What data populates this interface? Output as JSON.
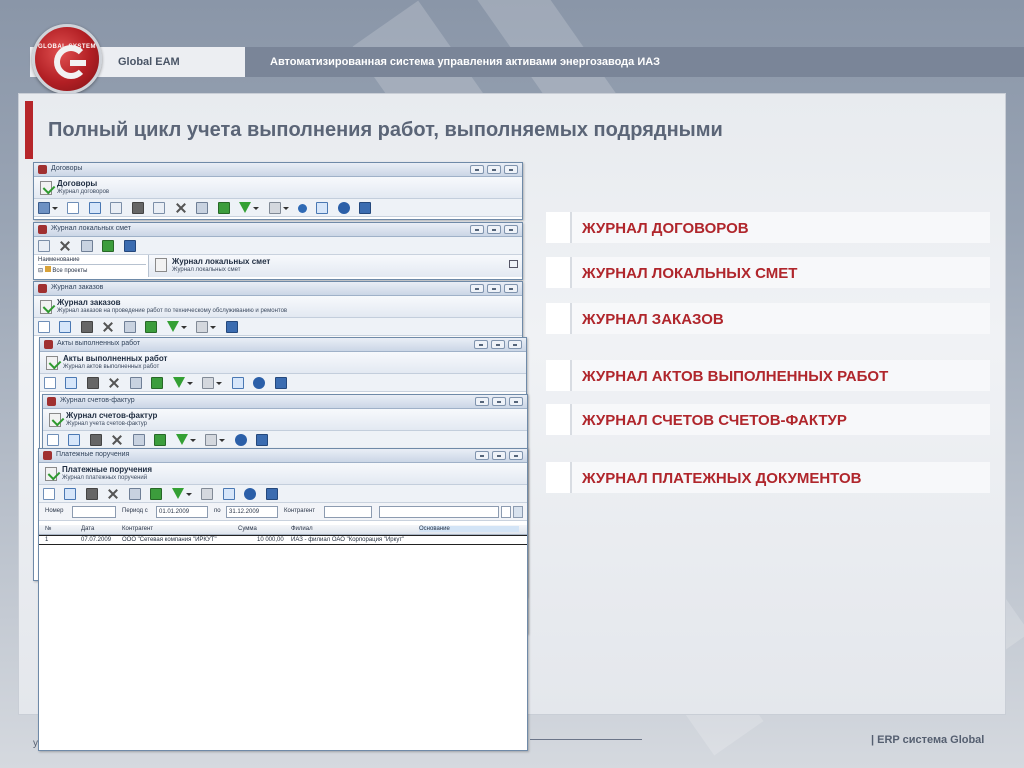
{
  "header": {
    "brand": "Global EAM",
    "subtitle": "Автоматизированная система управления активами энергозавода ИАЗ",
    "logo_text": "GLOBAL SYSTEM"
  },
  "slide": {
    "title": "Полный цикл учета выполнения работ, выполняемых подрядными"
  },
  "journals": [
    {
      "label": "ЖУРНАЛ ДОГОВОРОВ"
    },
    {
      "label": "ЖУРНАЛ ЛОКАЛЬНЫХ СМЕТ"
    },
    {
      "label": "ЖУРНАЛ ЗАКАЗОВ"
    },
    {
      "label": "ЖУРНАЛ АКТОВ ВЫПОЛНЕННЫХ РАБОТ"
    },
    {
      "label": "ЖУРНАЛ СЧЕТОВ СЧЕТОВ-ФАКТУР"
    },
    {
      "label": "ЖУРНАЛ ПЛАТЕЖНЫХ ДОКУМЕНТОВ"
    }
  ],
  "windows": {
    "contracts": {
      "title": "Договоры",
      "header": "Договоры",
      "sub": "Журнал договоров"
    },
    "estimates": {
      "title": "Журнал локальных смет",
      "header": "Журнал локальных смет",
      "sub": "Журнал локальных смет",
      "tree_header": "Наименование",
      "tree_item": "Все проекты"
    },
    "orders": {
      "title": "Журнал заказов",
      "header": "Журнал заказов",
      "sub": "Журнал заказов на проведение работ по техническому обслуживанию и ремонтов"
    },
    "acts": {
      "title": "Акты выполненных работ",
      "header": "Акты выполненных работ",
      "sub": "Журнал актов выполненных работ"
    },
    "invoices": {
      "title": "Журнал счетов-фактур",
      "header": "Журнал счетов-фактур",
      "sub": "Журнал учета счетов-фактур"
    },
    "payments": {
      "title": "Платежные поручения",
      "header": "Платежные поручения",
      "sub": "Журнал платежных поручений",
      "filter": {
        "number_label": "Номер",
        "period_label": "Период с",
        "date_from": "01.01.2009",
        "to_label": "по",
        "date_to": "31.12.2009",
        "counterparty_label": "Контрагент"
      },
      "columns": [
        "№",
        "Дата",
        "Контрагент",
        "Сумма",
        "Филиал",
        "Основание"
      ],
      "rows": [
        [
          "1",
          "07.07.2009",
          "ООО \"Сетевая компания \"ИРКУТ\"",
          "10 000,00",
          "ИАЗ - филиал ОАО \"Корпорация \"Иркут\"",
          ""
        ]
      ]
    }
  },
  "footer": {
    "label": "| ERP система Global",
    "tag": "у"
  }
}
